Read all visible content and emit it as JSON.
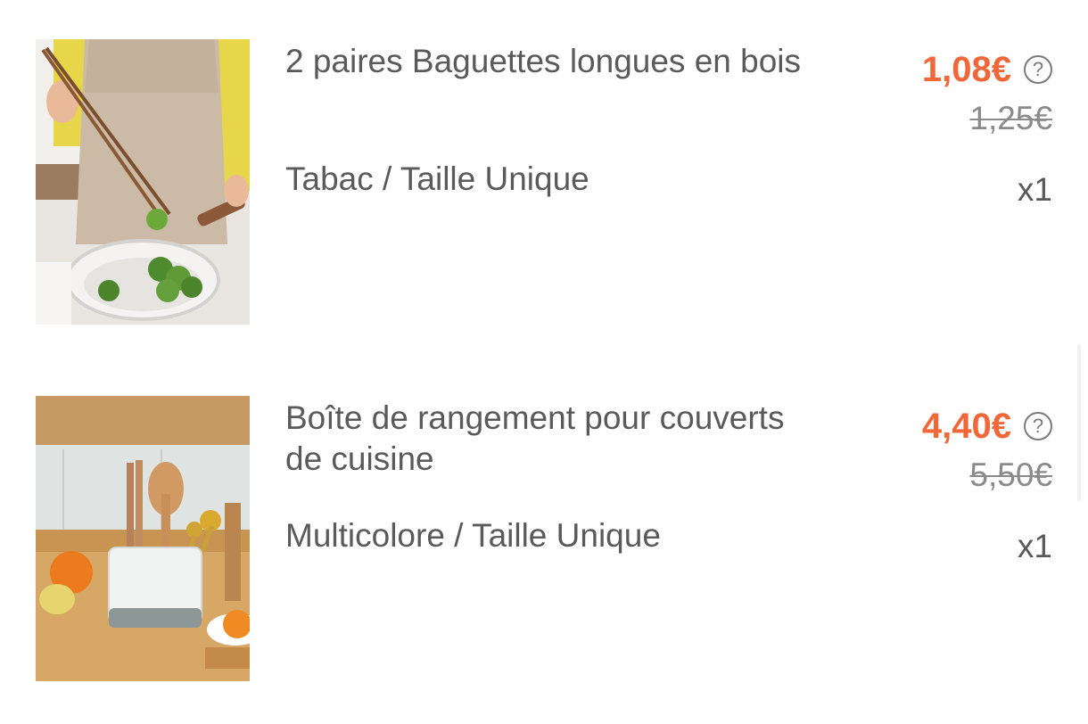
{
  "items": [
    {
      "name": "2 paires Baguettes longues en bois",
      "variant": "Tabac / Taille Unique",
      "price": "1,08€",
      "old_price": "1,25€",
      "quantity": "x1",
      "help_icon": "question-circle-icon"
    },
    {
      "name": "Boîte de rangement pour couverts de cuisine",
      "variant": "Multicolore / Taille Unique",
      "price": "4,40€",
      "old_price": "5,50€",
      "quantity": "x1",
      "help_icon": "question-circle-icon"
    }
  ],
  "colors": {
    "price": "#f0673a",
    "text": "#5a5a5a",
    "old_price": "#8a8a8a"
  }
}
